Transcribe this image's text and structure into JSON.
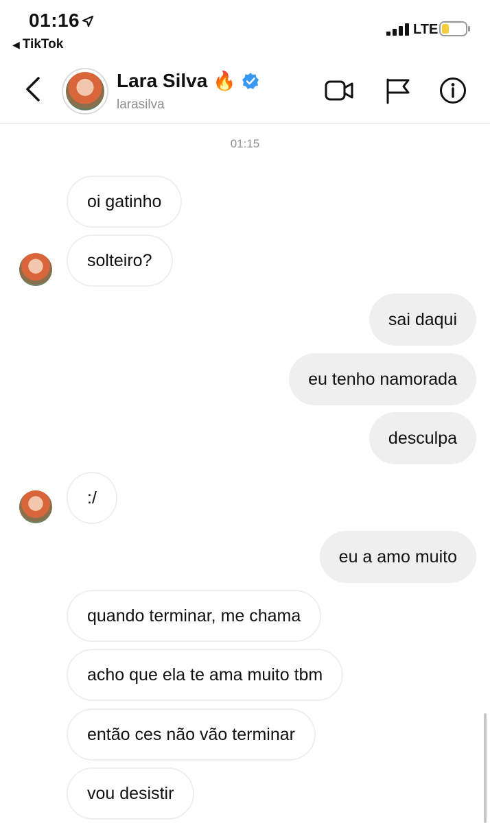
{
  "status_bar": {
    "time": "01:16",
    "back_app": "TikTok",
    "network": "LTE",
    "battery_color": "#f5cd3c"
  },
  "header": {
    "name": "Lara Silva",
    "emoji": "🔥",
    "username": "larasilva",
    "verified_color": "#3897f0",
    "icons": [
      "back-icon",
      "video-call-icon",
      "flag-icon",
      "info-icon"
    ]
  },
  "chat": {
    "timestamp": "01:15",
    "messages": [
      {
        "side": "incoming",
        "text": "oi gatinho"
      },
      {
        "side": "incoming",
        "text": "solteiro?"
      },
      {
        "side": "outgoing",
        "text": "sai daqui"
      },
      {
        "side": "outgoing",
        "text": "eu tenho namorada"
      },
      {
        "side": "outgoing",
        "text": "desculpa"
      },
      {
        "side": "incoming",
        "text": ":/"
      },
      {
        "side": "outgoing",
        "text": "eu a amo muito"
      },
      {
        "side": "incoming",
        "text": "quando terminar, me chama"
      },
      {
        "side": "incoming",
        "text": "acho que ela te ama muito tbm"
      },
      {
        "side": "incoming",
        "text": "então ces não vão terminar"
      },
      {
        "side": "incoming",
        "text": "vou desistir"
      }
    ]
  }
}
